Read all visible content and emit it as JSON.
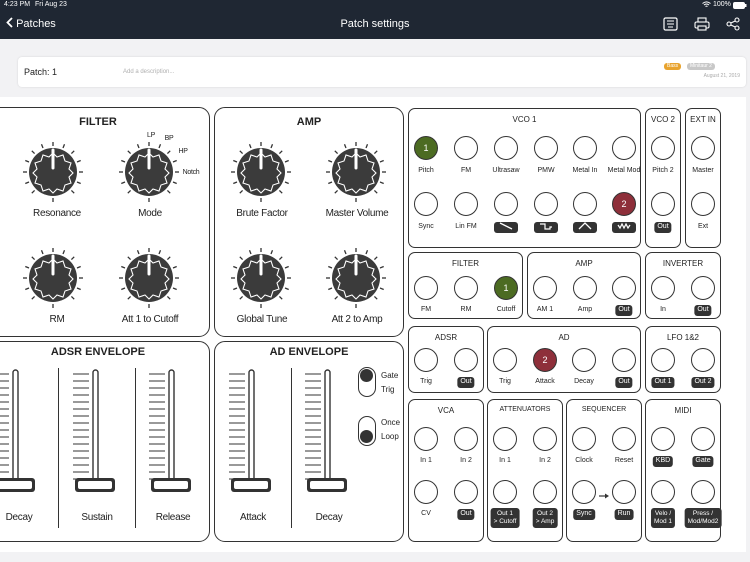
{
  "status_bar": {
    "time": "4:23 PM",
    "date": "Fri Aug 23",
    "battery": "100%"
  },
  "nav": {
    "back_label": "Patches",
    "title": "Patch settings",
    "icons": [
      "keyboard-icon",
      "print-icon",
      "share-icon"
    ]
  },
  "patch": {
    "name": "Patch: 1",
    "description_placeholder": "Add a description...",
    "tags": [
      {
        "label": "Bass",
        "color": "#e8a32e"
      },
      {
        "label": "Minitaur 2",
        "color": "#c8c8c8"
      }
    ],
    "date": "August 21, 2019"
  },
  "colors": {
    "nav_bg": "#1f2733",
    "green": "#4c6b22",
    "red": "#8e2f3a",
    "ink": "#333333"
  },
  "filter_panel": {
    "title": "FILTER",
    "knobs": [
      {
        "label": "Resonance"
      },
      {
        "label": "Mode",
        "mode_labels": [
          "LP",
          "BP",
          "HP",
          "Notch"
        ]
      },
      {
        "label": "RM"
      },
      {
        "label": "Att 1 to Cutoff"
      }
    ]
  },
  "amp_panel": {
    "title": "AMP",
    "knobs": [
      {
        "label": "Brute Factor"
      },
      {
        "label": "Master Volume"
      },
      {
        "label": "Global Tune"
      },
      {
        "label": "Att 2 to Amp"
      }
    ]
  },
  "adsr_panel": {
    "title": "ADSR ENVELOPE",
    "sliders": [
      {
        "label": "Decay"
      },
      {
        "label": "Sustain"
      },
      {
        "label": "Release"
      }
    ]
  },
  "ad_panel": {
    "title": "AD ENVELOPE",
    "sliders": [
      {
        "label": "Attack"
      },
      {
        "label": "Decay"
      }
    ],
    "toggles": [
      {
        "line1": "Gate",
        "line2": "Trig",
        "state": "up"
      },
      {
        "line1": "Once",
        "line2": "Loop",
        "state": "down"
      }
    ]
  },
  "modules": {
    "vco1": {
      "title": "VCO 1",
      "row1": [
        {
          "label": "Pitch",
          "value": "1",
          "color": "green"
        },
        {
          "label": "FM"
        },
        {
          "label": "Ultrasaw"
        },
        {
          "label": "PMW"
        },
        {
          "label": "Metal In"
        },
        {
          "label": "Metal Mod"
        }
      ],
      "row2": [
        {
          "label": "Sync"
        },
        {
          "label": "Lin FM"
        },
        {
          "wave": "saw"
        },
        {
          "wave": "square"
        },
        {
          "wave": "triangle"
        },
        {
          "wave": "metal",
          "value": "2",
          "color": "red"
        }
      ]
    },
    "vco2": {
      "title": "VCO 2",
      "jacks": [
        {
          "label": "Pitch 2"
        },
        {
          "label": "Out",
          "pill": true
        }
      ]
    },
    "ext_in": {
      "title": "EXT IN",
      "jacks": [
        {
          "label": "Master"
        },
        {
          "label": "Ext"
        }
      ]
    },
    "filter": {
      "title": "FILTER",
      "jacks": [
        {
          "label": "FM"
        },
        {
          "label": "RM"
        },
        {
          "label": "Cutoff",
          "value": "1",
          "color": "green"
        }
      ]
    },
    "amp": {
      "title": "AMP",
      "jacks": [
        {
          "label": "AM 1"
        },
        {
          "label": "Amp"
        },
        {
          "label": "Out",
          "pill": true
        }
      ]
    },
    "inverter": {
      "title": "INVERTER",
      "jacks": [
        {
          "label": "In"
        },
        {
          "label": "Out",
          "pill": true
        }
      ]
    },
    "adsr": {
      "title": "ADSR",
      "jacks": [
        {
          "label": "Trig"
        },
        {
          "label": "Out",
          "pill": true
        }
      ]
    },
    "ad": {
      "title": "AD",
      "jacks": [
        {
          "label": "Trig"
        },
        {
          "label": "Attack",
          "value": "2",
          "color": "red"
        },
        {
          "label": "Decay"
        },
        {
          "label": "Out",
          "pill": true
        }
      ]
    },
    "lfo": {
      "title": "LFO 1&2",
      "jacks": [
        {
          "label": "Out 1",
          "pill": true
        },
        {
          "label": "Out 2",
          "pill": true
        }
      ]
    },
    "vca": {
      "title": "VCA",
      "jacks": [
        {
          "label": "In 1"
        },
        {
          "label": "In 2"
        },
        {
          "label": "CV"
        },
        {
          "label": "Out",
          "pill": true
        }
      ]
    },
    "attenuators": {
      "title": "ATTENUATORS",
      "jacks": [
        {
          "label": "In 1"
        },
        {
          "label": "In 2"
        },
        {
          "label": "Out 1 > Cutoff",
          "line1": "Out 1",
          "line2": "> Cutoff",
          "pill": true
        },
        {
          "label": "Out 2 > Amp",
          "line1": "Out 2",
          "line2": "> Amp",
          "pill": true
        }
      ]
    },
    "sequencer": {
      "title": "SEQUENCER",
      "jacks": [
        {
          "label": "Clock"
        },
        {
          "label": "Reset"
        },
        {
          "label": "Sync",
          "pill": true
        },
        {
          "label": "Run",
          "pill": true
        }
      ]
    },
    "midi": {
      "title": "MIDI",
      "jacks": [
        {
          "label": "KBD",
          "pill": true
        },
        {
          "label": "Gate",
          "pill": true
        },
        {
          "label": "Velo / Mod 1",
          "line1": "Velo /",
          "line2": "Mod 1",
          "pill": true
        },
        {
          "label": "Press / Mod/Mod2",
          "line1": "Press /",
          "line2": "Mod/Mod2",
          "pill": true
        }
      ]
    }
  }
}
